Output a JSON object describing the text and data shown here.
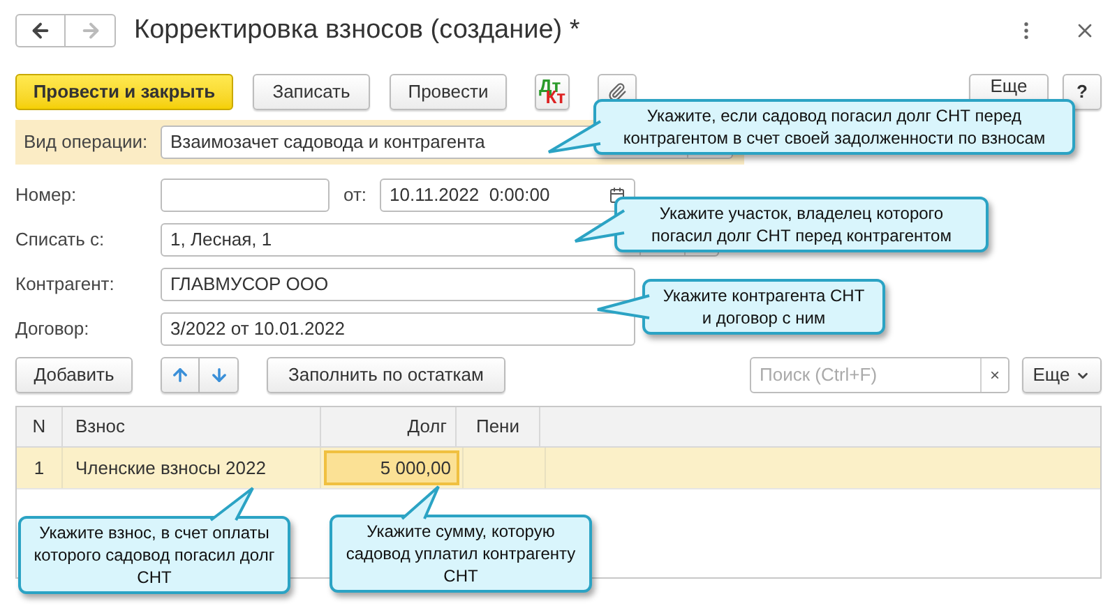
{
  "window": {
    "title": "Корректировка взносов (создание) *"
  },
  "toolbar": {
    "buttons": [
      {
        "kind": "primary",
        "label": "Провести и закрыть"
      },
      {
        "kind": "plain",
        "label": "Записать"
      },
      {
        "kind": "plain",
        "label": "Провести"
      },
      {
        "kind": "dtkt",
        "label": "Дт",
        "label2": "Кт"
      },
      {
        "kind": "clip"
      }
    ],
    "more": "Еще",
    "help": "?"
  },
  "operation": {
    "label": "Вид операции:",
    "value": "Взаимозачет садовода и контрагента"
  },
  "number": {
    "label": "Номер:",
    "date_label": "от:",
    "date": "10.11.2022  0:00:00"
  },
  "fields": [
    {
      "label": "Списать с:",
      "value": "1, Лесная, 1"
    },
    {
      "label": "Контрагент:",
      "value": "ГЛАВМУСОР ООО"
    },
    {
      "label": "Договор:",
      "value": "3/2022 от 10.01.2022"
    }
  ],
  "table_toolbar": {
    "add": "Добавить",
    "fill": "Заполнить по остаткам",
    "search": {
      "placeholder": "Поиск (Ctrl+F)",
      "clear": "×"
    },
    "more": "Еще"
  },
  "table": {
    "columns": [
      "N",
      "Взнос",
      "Долг",
      "Пени"
    ],
    "rows": [
      {
        "n": "1",
        "fee": "Членские взносы 2022",
        "debt": "5 000,00",
        "selected": true
      }
    ]
  },
  "callouts": [
    {
      "text": "Укажите, если садовод погасил долг СНТ перед контрагентом в счет своей задолженности по взносам"
    },
    {
      "text": "Укажите участок, владелец которого погасил долг СНТ перед контрагентом"
    },
    {
      "text": "Укажите контрагента СНТ и договор с ним"
    },
    {
      "text": "Укажите взнос, в счет оплаты которого садовод погасил долг СНТ"
    },
    {
      "text": "Укажите сумму, которую садовод уплатил контрагенту СНТ"
    }
  ]
}
